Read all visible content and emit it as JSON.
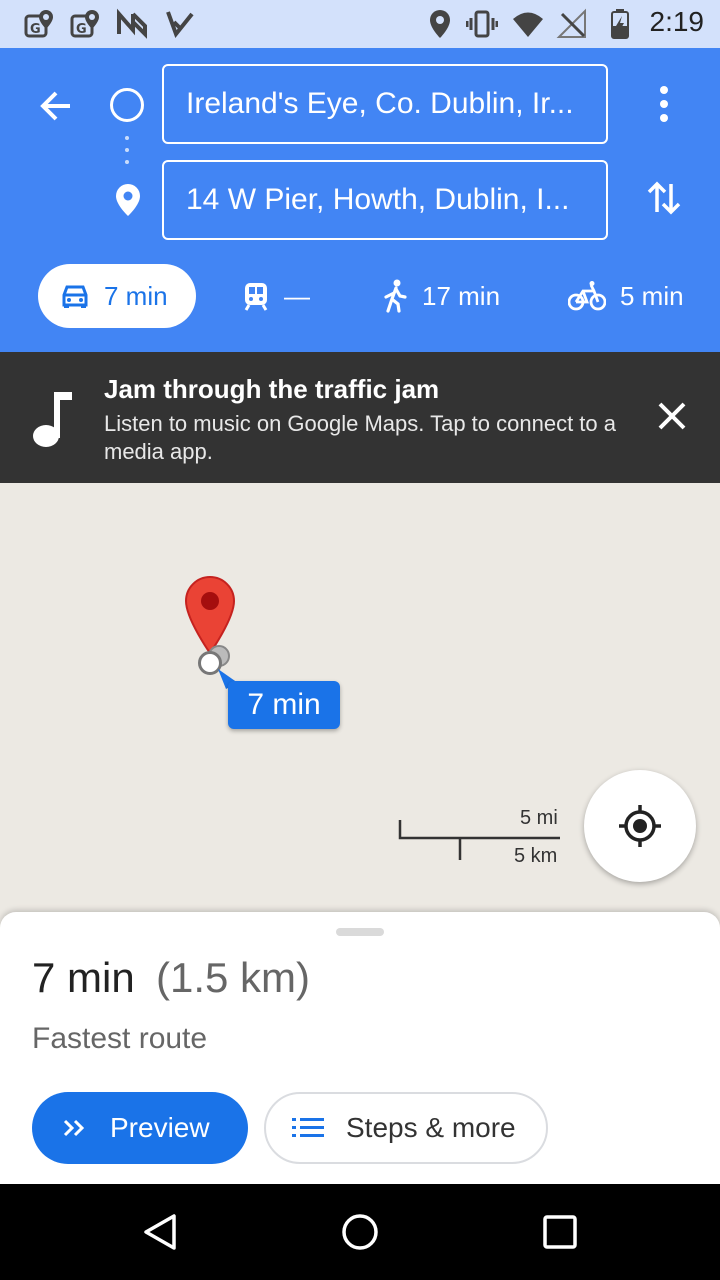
{
  "status_bar": {
    "time": "2:19",
    "icons": [
      "maps-notification-icon",
      "maps-notification-icon",
      "n-logo-icon",
      "check-logo-icon",
      "location-icon",
      "vibrate-icon",
      "wifi-icon",
      "no-signal-icon",
      "battery-charging-icon"
    ]
  },
  "header": {
    "origin": "Ireland's Eye, Co. Dublin, Ir...",
    "destination": "14 W Pier, Howth, Dublin, I...",
    "modes": {
      "drive": "7 min",
      "transit": "—",
      "walk": "17 min",
      "bike": "5 min"
    },
    "selected_mode": "drive"
  },
  "promo": {
    "title": "Jam through the traffic jam",
    "body": "Listen to music on Google Maps. Tap to connect to a media app."
  },
  "map": {
    "callout": "7 min",
    "scale_mi": "5 mi",
    "scale_km": "5 km"
  },
  "sheet": {
    "time": "7 min",
    "distance": "(1.5 km)",
    "subtitle": "Fastest route",
    "preview_label": "Preview",
    "steps_label": "Steps & more"
  },
  "colors": {
    "header_blue": "#4285f4",
    "accent_blue": "#1a73e8",
    "pin_red": "#ea4335",
    "promo_bg": "#333333"
  }
}
